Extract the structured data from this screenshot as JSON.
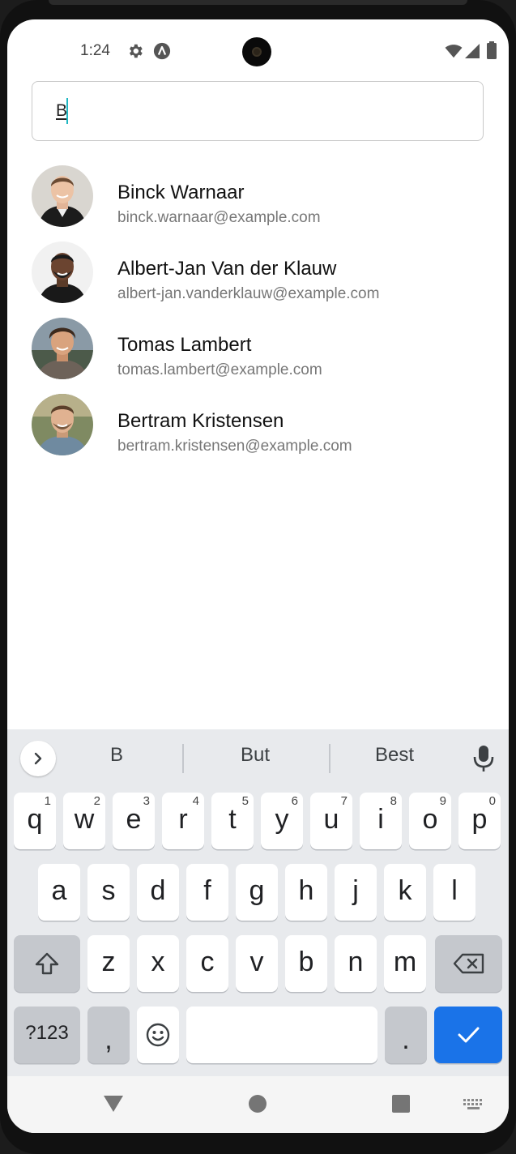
{
  "status": {
    "time": "1:24"
  },
  "search": {
    "value": "B"
  },
  "contacts": [
    {
      "name": "Binck Warnaar",
      "email": "binck.warnaar@example.com"
    },
    {
      "name": "Albert-Jan Van der Klauw",
      "email": "albert-jan.vanderklauw@example.com"
    },
    {
      "name": "Tomas Lambert",
      "email": "tomas.lambert@example.com"
    },
    {
      "name": "Bertram Kristensen",
      "email": "bertram.kristensen@example.com"
    }
  ],
  "keyboard": {
    "suggestions": [
      "B",
      "But",
      "Best"
    ],
    "row1": [
      {
        "key": "q",
        "num": "1"
      },
      {
        "key": "w",
        "num": "2"
      },
      {
        "key": "e",
        "num": "3"
      },
      {
        "key": "r",
        "num": "4"
      },
      {
        "key": "t",
        "num": "5"
      },
      {
        "key": "y",
        "num": "6"
      },
      {
        "key": "u",
        "num": "7"
      },
      {
        "key": "i",
        "num": "8"
      },
      {
        "key": "o",
        "num": "9"
      },
      {
        "key": "p",
        "num": "0"
      }
    ],
    "row2": [
      "a",
      "s",
      "d",
      "f",
      "g",
      "h",
      "j",
      "k",
      "l"
    ],
    "row3": [
      "z",
      "x",
      "c",
      "v",
      "b",
      "n",
      "m"
    ],
    "symbols_label": "?123",
    "comma": ",",
    "period": ".",
    "accent_color": "#1a73e8"
  }
}
